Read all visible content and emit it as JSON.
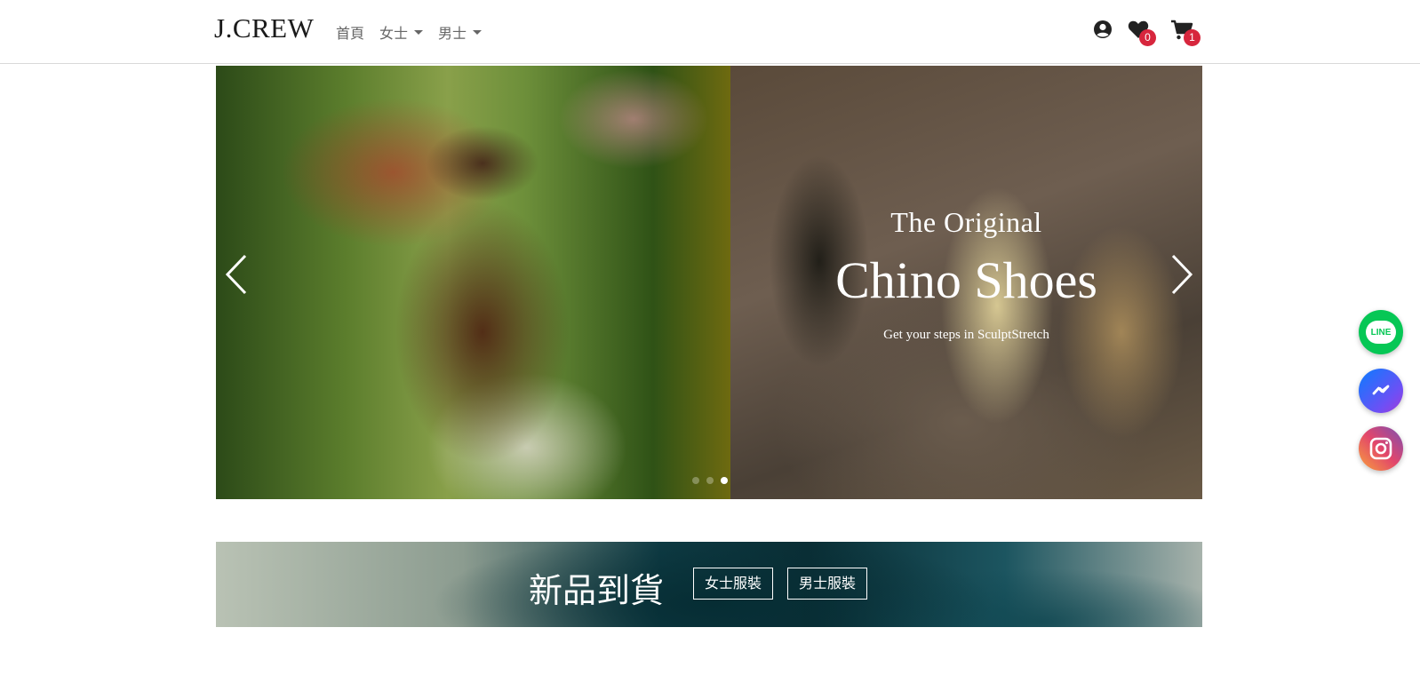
{
  "header": {
    "logo": "J.CREW",
    "nav": [
      {
        "label": "首頁"
      },
      {
        "label": "女士"
      },
      {
        "label": "男士"
      }
    ],
    "wishlist_count": "0",
    "cart_count": "1"
  },
  "carousel": {
    "kicker": "The Original",
    "title": "Chino Shoes",
    "subtitle": "Get your steps in SculptStretch",
    "slide_count": 3,
    "active_slide": 3
  },
  "banner": {
    "title": "新品到貨",
    "women_button": "女士服裝",
    "men_button": "男士服裝"
  },
  "social": {
    "line_label": "LINE"
  },
  "colors": {
    "badge": "#d7263d",
    "line": "#06c755",
    "messenger": "#0a7cff"
  }
}
